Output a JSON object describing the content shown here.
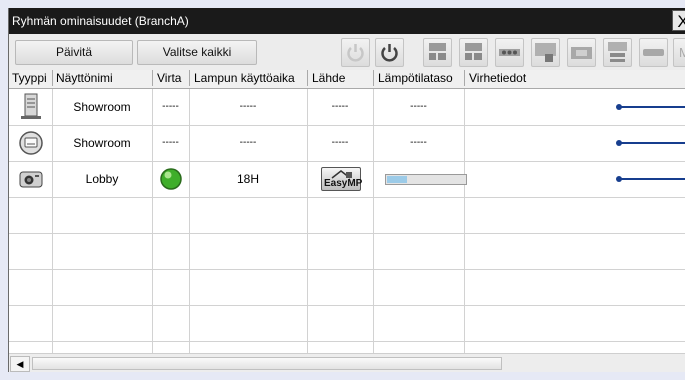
{
  "window": {
    "title": "Ryhmän ominaisuudet (BranchA)",
    "close_label": "X"
  },
  "toolbar": {
    "refresh_label": "Päivitä",
    "select_all_label": "Valitse kaikki",
    "icons": [
      "power-on-icon",
      "power-off-icon",
      "computer1-source-icon",
      "computer2-source-icon",
      "video-source-icon",
      "svideo-source-icon",
      "audio-video-mute-icon",
      "lan-source-icon",
      "hdmi-source-icon",
      "m-source-icon"
    ],
    "partial_label": "M"
  },
  "columns": [
    "Tyyppi",
    "Näyttönimi",
    "Virta",
    "Lampun käyttöaika",
    "Lähde",
    "Lämpötilataso",
    "Virhetiedot"
  ],
  "rows": [
    {
      "type_icon": "tower-icon",
      "name": "Showroom",
      "power": "-----",
      "lamp_hours": "-----",
      "source": "-----",
      "temperature": "-----",
      "error": ""
    },
    {
      "type_icon": "projector-front-icon",
      "name": "Showroom",
      "power": "-----",
      "lamp_hours": "-----",
      "source": "-----",
      "temperature": "-----",
      "error": ""
    },
    {
      "type_icon": "projector-camera-icon",
      "name": "Lobby",
      "power_icon": "power-status-green-icon",
      "lamp_hours": "18H",
      "source_label": "EasyMP",
      "temperature_level": 0.25,
      "error": ""
    }
  ],
  "empty_rows": 5,
  "colors": {
    "titlebar": "#1a1a1a",
    "callout": "#173e8e",
    "power_green": "#3fae2a",
    "background": "#e6e9f5"
  }
}
